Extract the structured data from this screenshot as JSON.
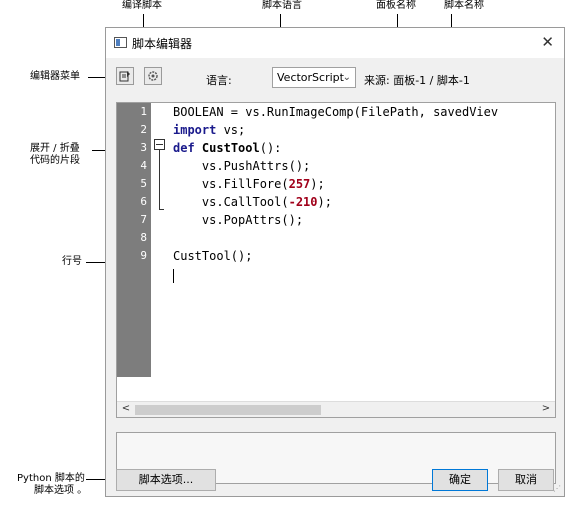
{
  "callouts": {
    "compile_script": "编译脚本",
    "script_language": "脚本语言",
    "panel_name": "面板名称",
    "script_name": "脚本名称",
    "editor_menu": "编辑器菜单",
    "expand_collapse_line1": "展开 / 折叠",
    "expand_collapse_line2": "代码的片段",
    "line_number": "行号",
    "python_options_line1": "Python 脚本的",
    "python_options_line2": "脚本选项 。"
  },
  "window": {
    "title": "脚本编辑器",
    "close_glyph": "✕"
  },
  "toolbar": {
    "compile_icon": "compile-icon",
    "settings_icon": "settings-icon",
    "language_label": "语言:",
    "language_value": "VectorScript",
    "source_text": "来源: 面板-1 / 脚本-1"
  },
  "editor": {
    "line_numbers": [
      "1",
      "2",
      "3",
      "4",
      "5",
      "6",
      "7",
      "8",
      "9"
    ],
    "code": {
      "l1": "BOOLEAN = vs.RunImageComp(FilePath, savedViev",
      "l2_kw": "import",
      "l2_rest": " vs;",
      "l3_kw": "def",
      "l3_fn": "CustTool",
      "l3_rest": "():",
      "l4": "    vs.PushAttrs();",
      "l5_pre": "    vs.FillFore(",
      "l5_num": "257",
      "l5_post": ");",
      "l6_pre": "    vs.CallTool(",
      "l6_num": "-210",
      "l6_post": ");",
      "l7": "    vs.PopAttrs();",
      "l9": "CustTool();"
    },
    "scroll_left": "<",
    "scroll_right": ">"
  },
  "footer": {
    "script_options_label": "脚本选项...",
    "ok_label": "确定",
    "cancel_label": "取消"
  }
}
